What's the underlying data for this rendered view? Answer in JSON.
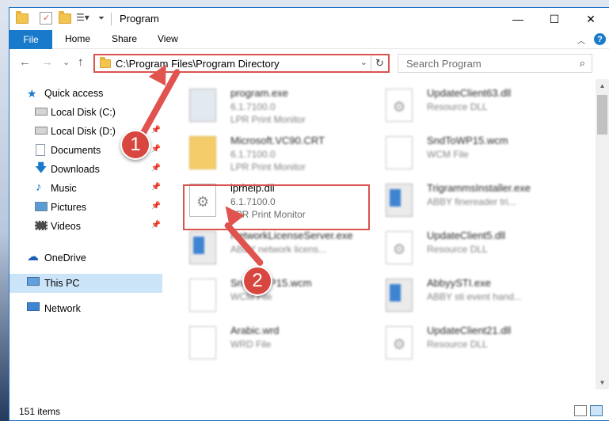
{
  "window": {
    "title": "Program",
    "minimize_label": "—",
    "maximize_label": "☐",
    "close_label": "✕"
  },
  "ribbon": {
    "tabs": [
      "File",
      "Home",
      "Share",
      "View"
    ],
    "help_label": "?"
  },
  "nav": {
    "back_label": "←",
    "forward_label": "→",
    "recent_label": "⌄",
    "up_label": "↑",
    "address": "C:\\Program Files\\Program Directory",
    "search_placeholder": "Search Program"
  },
  "sidebar": {
    "items": [
      {
        "label": "Quick access",
        "icon": "star-icon"
      },
      {
        "label": "Local Disk (C:)",
        "icon": "drive-icon"
      },
      {
        "label": "Local Disk (D:)",
        "icon": "drive-icon"
      },
      {
        "label": "Documents",
        "icon": "documents-icon"
      },
      {
        "label": "Downloads",
        "icon": "download-icon"
      },
      {
        "label": "Music",
        "icon": "music-icon"
      },
      {
        "label": "Pictures",
        "icon": "pictures-icon"
      },
      {
        "label": "Videos",
        "icon": "videos-icon"
      },
      {
        "label": "OneDrive",
        "icon": "cloud-icon"
      },
      {
        "label": "This PC",
        "icon": "computer-icon"
      },
      {
        "label": "Network",
        "icon": "network-icon"
      }
    ]
  },
  "files": [
    {
      "name": "program.exe",
      "sub1": "6.1.7100.0",
      "sub2": "LPR Print Monitor"
    },
    {
      "name": "UpdateClient63.dll",
      "sub1": "Resource DLL",
      "sub2": ""
    },
    {
      "name": "Microsoft.VC90.CRT",
      "sub1": "6.1.7100.0",
      "sub2": "LPR Print Monitor"
    },
    {
      "name": "SndToWP15.wcm",
      "sub1": "WCM File",
      "sub2": ""
    },
    {
      "name": "lprhelp.dll",
      "sub1": "6.1.7100.0",
      "sub2": "LPR Print Monitor"
    },
    {
      "name": "TrigrammsInstaller.exe",
      "sub1": "ABBY finereader tri...",
      "sub2": ""
    },
    {
      "name": "NetworkLicenseServer.exe",
      "sub1": "ABBY network licens...",
      "sub2": ""
    },
    {
      "name": "UpdateClient5.dll",
      "sub1": "Resource DLL",
      "sub2": ""
    },
    {
      "name": "SndToWP15.wcm",
      "sub1": "WCM File",
      "sub2": ""
    },
    {
      "name": "AbbyySTI.exe",
      "sub1": "ABBY sti event hand...",
      "sub2": ""
    },
    {
      "name": "Arabic.wrd",
      "sub1": "WRD File",
      "sub2": ""
    },
    {
      "name": "UpdateClient21.dll",
      "sub1": "Resource DLL",
      "sub2": ""
    }
  ],
  "status": {
    "items_count": "151 items"
  },
  "annotations": {
    "step1": "1",
    "step2": "2"
  },
  "colors": {
    "accent": "#1979ca",
    "highlight": "#d9534f",
    "selected": "#cce4f7"
  }
}
